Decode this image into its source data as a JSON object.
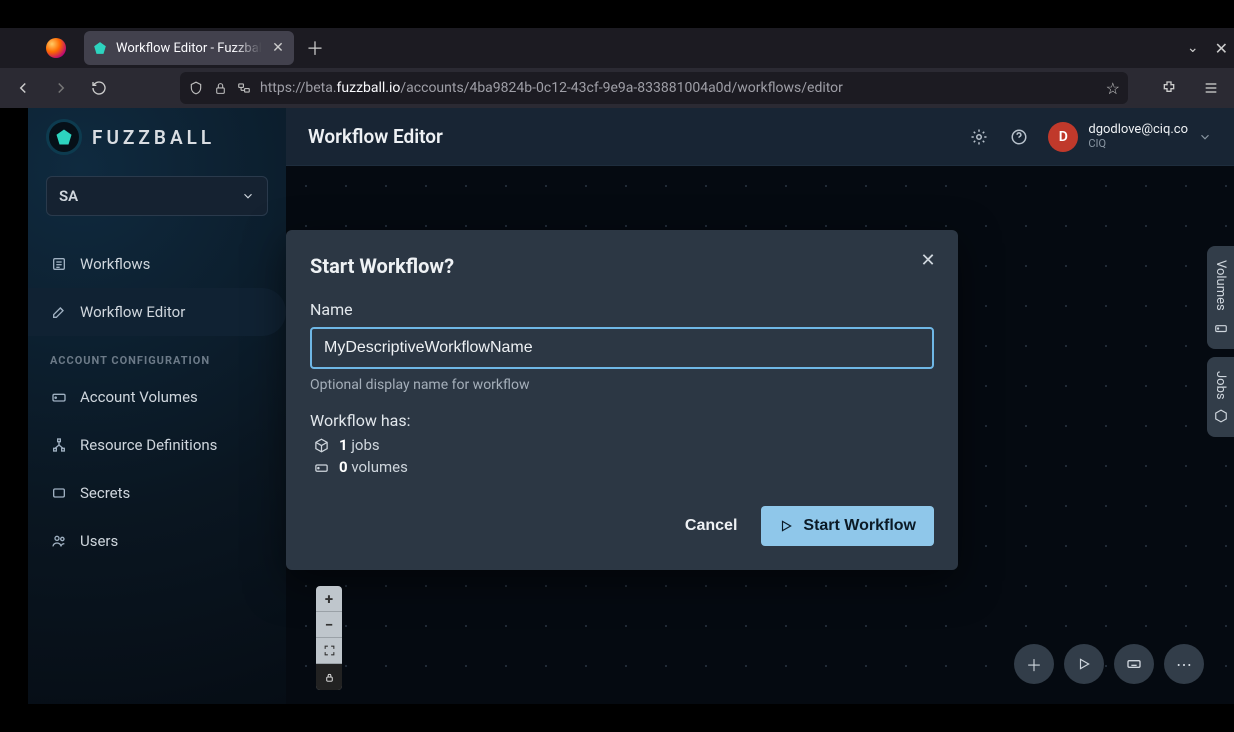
{
  "browser": {
    "tab_title": "Workflow Editor - Fuzzball",
    "url_prefix": "https://beta.",
    "url_domain": "fuzzball.io",
    "url_path": "/accounts/4ba9824b-0c12-43cf-9e9a-833881004a0d/workflows/editor"
  },
  "logo_text": "FUZZBALL",
  "account_selector": {
    "label": "SA"
  },
  "sidebar": {
    "items": [
      {
        "label": "Workflows"
      },
      {
        "label": "Workflow Editor"
      }
    ],
    "section_label": "ACCOUNT CONFIGURATION",
    "config_items": [
      {
        "label": "Account Volumes"
      },
      {
        "label": "Resource Definitions"
      },
      {
        "label": "Secrets"
      },
      {
        "label": "Users"
      }
    ]
  },
  "appbar": {
    "title": "Workflow Editor",
    "user_email": "dgodlove@ciq.co",
    "user_org": "CIQ",
    "avatar_initial": "D"
  },
  "rail": {
    "volumes": "Volumes",
    "jobs": "Jobs"
  },
  "modal": {
    "title": "Start Workflow?",
    "name_label": "Name",
    "name_value": "MyDescriptiveWorkflowName",
    "name_helper": "Optional display name for workflow",
    "summary_label": "Workflow has:",
    "jobs_count": "1",
    "jobs_label": " jobs",
    "volumes_count": "0",
    "volumes_label": " volumes",
    "cancel": "Cancel",
    "start": "Start Workflow"
  }
}
